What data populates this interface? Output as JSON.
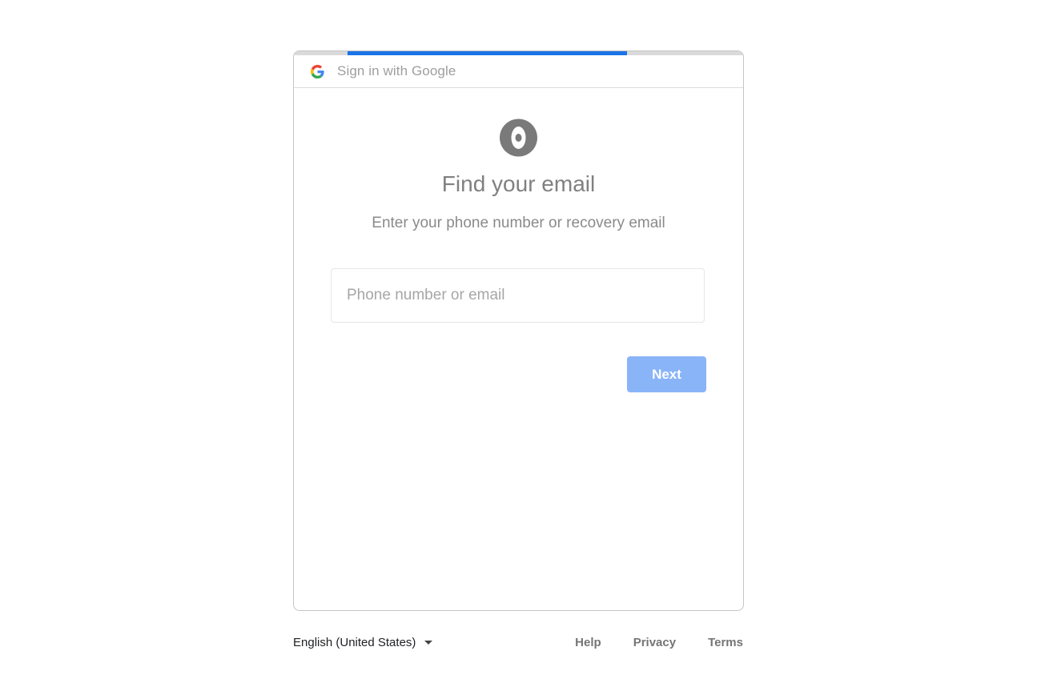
{
  "progress": {
    "fill_start_fraction": 0.119,
    "fill_end_fraction": 0.742,
    "color": "#1a73e8"
  },
  "header": {
    "icon": "google-g-icon",
    "title": "Sign in with Google"
  },
  "main": {
    "app_logo_icon": "app-logo-icon",
    "title": "Find your email",
    "subtitle": "Enter your phone number or recovery email",
    "input": {
      "placeholder": "Phone number or email",
      "value": ""
    },
    "next_button": {
      "label": "Next",
      "color": "#8ab4f8"
    }
  },
  "footer": {
    "language": "English (United States)",
    "links": [
      "Help",
      "Privacy",
      "Terms"
    ]
  }
}
